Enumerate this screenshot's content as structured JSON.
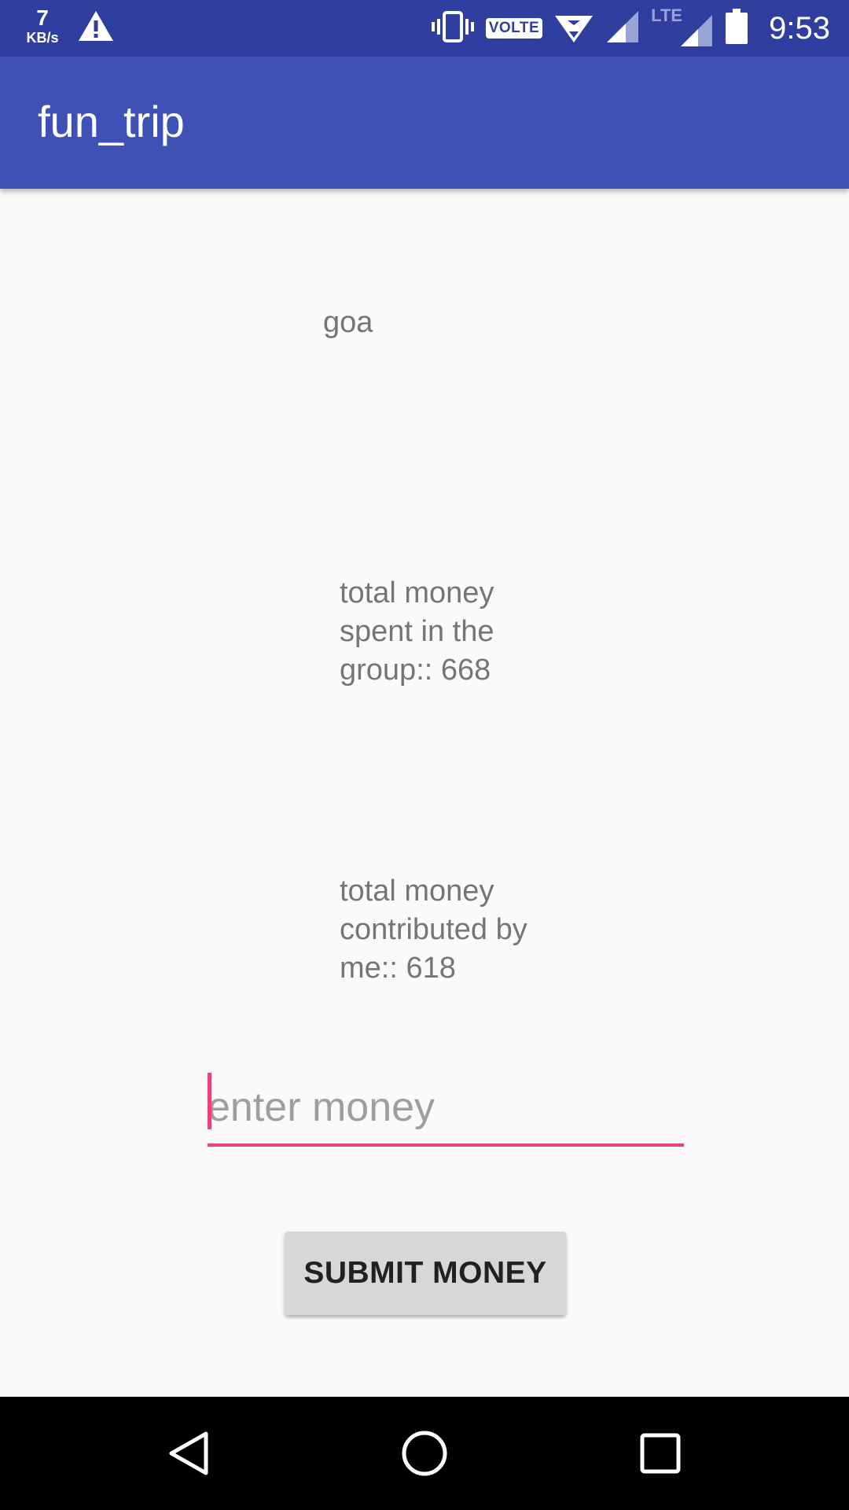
{
  "status_bar": {
    "net_speed_value": "7",
    "net_speed_unit": "KB/s",
    "volte_label": "VOLTE",
    "lte_label": "LTE",
    "time": "9:53",
    "icons": [
      "warning-icon",
      "vibrate-icon",
      "volte-icon",
      "wifi-icon",
      "signal-icon",
      "signal-icon",
      "battery-icon"
    ]
  },
  "app_bar": {
    "title": "fun_trip"
  },
  "main": {
    "trip_name": "goa",
    "total_spent_text": "total money\nspent in the\ngroup:: 668",
    "my_contribution_text": "total money\ncontributed by\nme::  618",
    "money_input": {
      "value": "",
      "placeholder": "enter money"
    },
    "submit_button_label": "SUBMIT MONEY"
  },
  "nav_bar": {
    "icons": [
      "back-icon",
      "home-icon",
      "recent-apps-icon"
    ]
  },
  "colors": {
    "status_bar": "#303f9f",
    "app_bar": "#3f51b5",
    "accent": "#ec407a",
    "background": "#fafafa",
    "button": "#d6d7d7"
  }
}
